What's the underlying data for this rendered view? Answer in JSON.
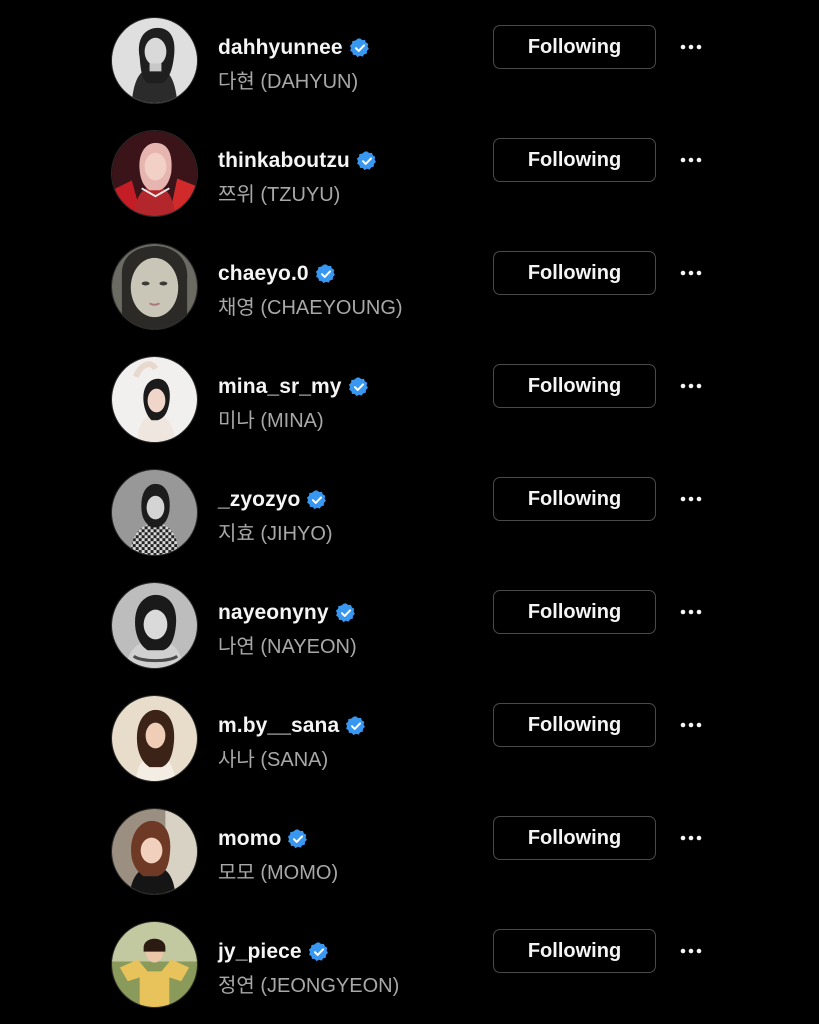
{
  "following_button_label": "Following",
  "colors": {
    "background": "#000000",
    "verified_badge": "#3897f0",
    "username": "#f5f5f5",
    "fullname": "#a8a8a8",
    "button_border": "#4a4a4a"
  },
  "icons": {
    "verified": "verified-badge-icon",
    "more": "more-options-icon"
  },
  "accounts": [
    {
      "username": "dahhyunnee",
      "fullname": "다현 (DAHYUN)",
      "verified": true,
      "button": "Following"
    },
    {
      "username": "thinkaboutzu",
      "fullname": "쯔위 (TZUYU)",
      "verified": true,
      "button": "Following"
    },
    {
      "username": "chaeyo.0",
      "fullname": "채영 (CHAEYOUNG)",
      "verified": true,
      "button": "Following"
    },
    {
      "username": "mina_sr_my",
      "fullname": "미나 (MINA)",
      "verified": true,
      "button": "Following"
    },
    {
      "username": "_zyozyo",
      "fullname": "지효 (JIHYO)",
      "verified": true,
      "button": "Following"
    },
    {
      "username": "nayeonyny",
      "fullname": "나연 (NAYEON)",
      "verified": true,
      "button": "Following"
    },
    {
      "username": "m.by__sana",
      "fullname": "사나 (SANA)",
      "verified": true,
      "button": "Following"
    },
    {
      "username": "momo",
      "fullname": "모모 (MOMO)",
      "verified": true,
      "button": "Following"
    },
    {
      "username": "jy_piece",
      "fullname": "정연 (JEONGYEON)",
      "verified": true,
      "button": "Following"
    }
  ]
}
